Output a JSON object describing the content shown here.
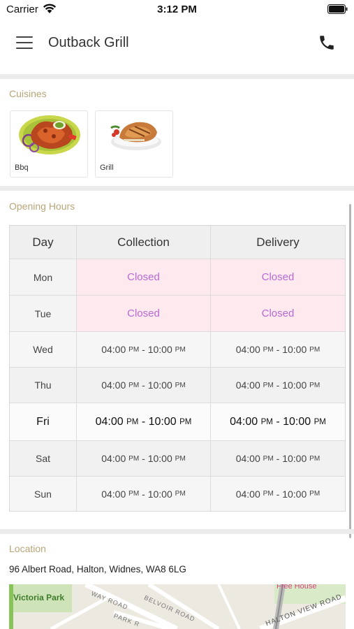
{
  "status_bar": {
    "carrier": "Carrier",
    "time": "3:12 PM",
    "wifi_icon": "wifi-icon",
    "battery_icon": "battery-icon"
  },
  "header": {
    "title": "Outback Grill",
    "menu_icon": "hamburger-menu-icon",
    "call_icon": "phone-icon"
  },
  "cuisines": {
    "heading": "Cuisines",
    "items": [
      {
        "label": "Bbq",
        "image": "bbq-chicken-plate"
      },
      {
        "label": "Grill",
        "image": "grilled-chicken-plate"
      }
    ]
  },
  "opening_hours": {
    "heading": "Opening Hours",
    "columns": [
      "Day",
      "Collection",
      "Delivery"
    ],
    "rows": [
      {
        "day": "Mon",
        "collection": "Closed",
        "delivery": "Closed"
      },
      {
        "day": "Tue",
        "collection": "Closed",
        "delivery": "Closed"
      },
      {
        "day": "Wed",
        "collection_from": "04:00",
        "collection_from_ampm": "PM",
        "collection_to": "10:00",
        "collection_to_ampm": "PM",
        "delivery_from": "04:00",
        "delivery_from_ampm": "PM",
        "delivery_to": "10:00",
        "delivery_to_ampm": "PM"
      },
      {
        "day": "Thu",
        "collection_from": "04:00",
        "collection_from_ampm": "PM",
        "collection_to": "10:00",
        "collection_to_ampm": "PM",
        "delivery_from": "04:00",
        "delivery_from_ampm": "PM",
        "delivery_to": "10:00",
        "delivery_to_ampm": "PM"
      },
      {
        "day": "Fri",
        "collection_from": "04:00",
        "collection_from_ampm": "PM",
        "collection_to": "10:00",
        "collection_to_ampm": "PM",
        "delivery_from": "04:00",
        "delivery_from_ampm": "PM",
        "delivery_to": "10:00",
        "delivery_to_ampm": "PM"
      },
      {
        "day": "Sat",
        "collection_from": "04:00",
        "collection_from_ampm": "PM",
        "collection_to": "10:00",
        "collection_to_ampm": "PM",
        "delivery_from": "04:00",
        "delivery_from_ampm": "PM",
        "delivery_to": "10:00",
        "delivery_to_ampm": "PM"
      },
      {
        "day": "Sun",
        "collection_from": "04:00",
        "collection_from_ampm": "PM",
        "collection_to": "10:00",
        "collection_to_ampm": "PM",
        "delivery_from": "04:00",
        "delivery_from_ampm": "PM",
        "delivery_to": "10:00",
        "delivery_to_ampm": "PM"
      }
    ],
    "sep": " - "
  },
  "location": {
    "heading": "Location",
    "address": "96 Albert Road, Halton, Widnes, WA8 6LG",
    "map_labels": [
      "Victoria Park",
      "WAY ROAD",
      "BELVOIR ROAD",
      "PARK R",
      "Free House",
      "HALTON VIEW ROAD"
    ]
  },
  "colors": {
    "section_label": "#b9a57a",
    "closed_text": "#b96ad3",
    "closed_bg": "#fde9ee"
  }
}
